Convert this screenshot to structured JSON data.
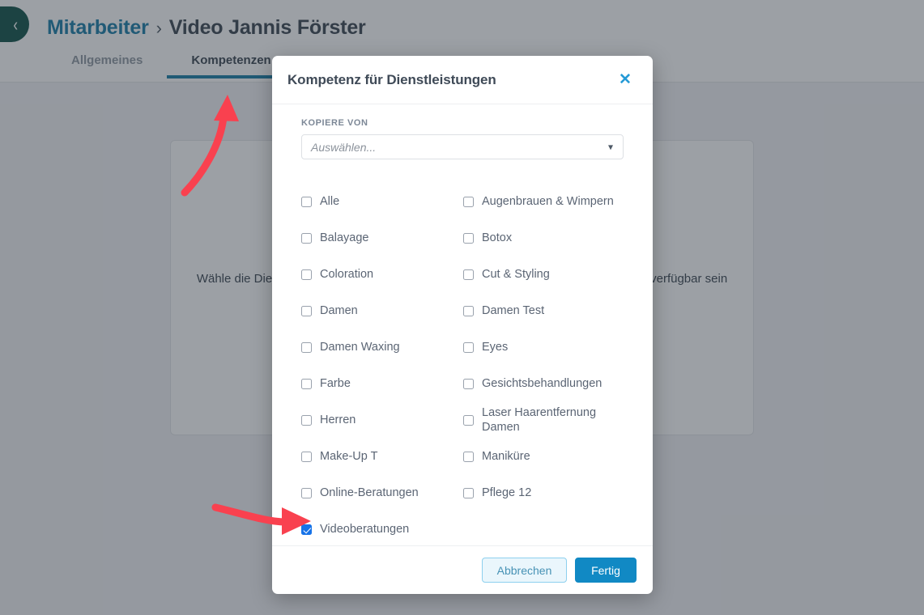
{
  "header": {
    "back_button_icon": "chevron-left-icon",
    "breadcrumb": {
      "root": "Mitarbeiter",
      "separator": "›",
      "current": "Video Jannis Förster"
    },
    "tabs": [
      {
        "label": "Allgemeines",
        "active": false
      },
      {
        "label": "Kompetenzen",
        "active": true
      }
    ]
  },
  "background_card": {
    "text": "Wähle die Dienstleistungen aus, die von diesem Mitarbeiter bei der Online-Buchung verfügbar sein sollen, damit der Kunde sie auswählen kann ist und die"
  },
  "modal": {
    "title": "Kompetenz für Dienstleistungen",
    "close_icon": "close-icon",
    "copy_from": {
      "label": "KOPIERE VON",
      "placeholder": "Auswählen...",
      "value": "Auswählen...",
      "caret_icon": "chevron-down-icon"
    },
    "services": [
      {
        "label": "Alle",
        "checked": false
      },
      {
        "label": "Augenbrauen & Wimpern",
        "checked": false
      },
      {
        "label": "Balayage",
        "checked": false
      },
      {
        "label": "Botox",
        "checked": false
      },
      {
        "label": "Coloration",
        "checked": false
      },
      {
        "label": "Cut & Styling",
        "checked": false
      },
      {
        "label": "Damen",
        "checked": false
      },
      {
        "label": "Damen Test",
        "checked": false
      },
      {
        "label": "Damen Waxing",
        "checked": false
      },
      {
        "label": "Eyes",
        "checked": false
      },
      {
        "label": "Farbe",
        "checked": false
      },
      {
        "label": "Gesichtsbehandlungen",
        "checked": false
      },
      {
        "label": "Herren",
        "checked": false
      },
      {
        "label": "Laser Haarentfernung Damen",
        "checked": false
      },
      {
        "label": "Make-Up T",
        "checked": false
      },
      {
        "label": "Maniküre",
        "checked": false
      },
      {
        "label": "Online-Beratungen",
        "checked": false
      },
      {
        "label": "Pflege 12",
        "checked": false
      },
      {
        "label": "Videoberatungen",
        "checked": true
      }
    ],
    "footer": {
      "cancel_label": "Abbrechen",
      "done_label": "Fertig"
    }
  },
  "annotations": {
    "color": "#f9414f",
    "arrow_to_tab": "arrow-pointing-to-kompetenzen-tab",
    "arrow_to_checkbox": "arrow-pointing-to-videoberatungen-checkbox"
  },
  "colors": {
    "brand_dark_green": "#14534a",
    "link_blue": "#1c7ea8",
    "tab_underline": "#1b7ea6",
    "primary_blue": "#1189c4",
    "checkbox_checked": "#1773e8",
    "overlay": "#282f3a",
    "page_bg": "#f2f3f5"
  }
}
